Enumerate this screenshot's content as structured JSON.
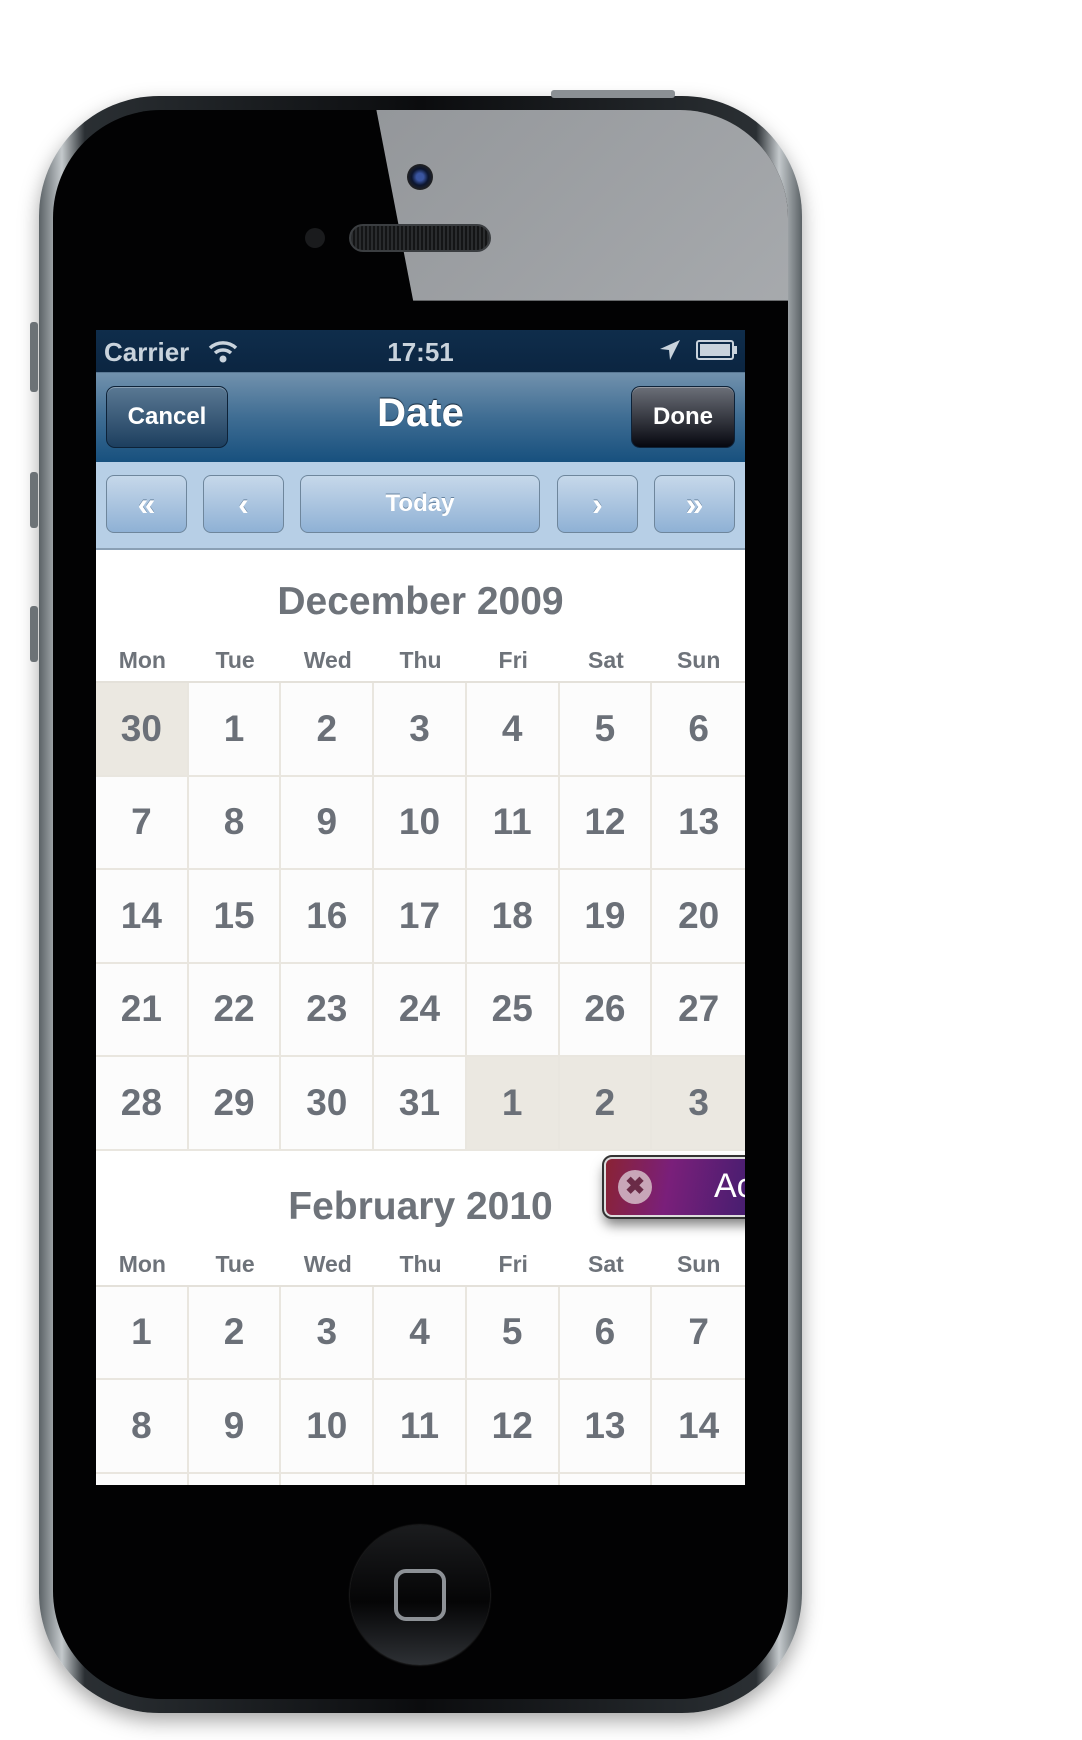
{
  "status_bar": {
    "carrier": "Carrier",
    "time": "17:51",
    "wifi_icon": "wifi-icon",
    "location_icon": "location-arrow-icon",
    "battery_icon": "battery-icon"
  },
  "nav_bar": {
    "title": "Date",
    "cancel_label": "Cancel",
    "done_label": "Done"
  },
  "toolbar": {
    "prev_year": "«",
    "prev_month": "‹",
    "today_label": "Today",
    "next_month": "›",
    "next_year": "»"
  },
  "weekdays": [
    "Mon",
    "Tue",
    "Wed",
    "Thu",
    "Fri",
    "Sat",
    "Sun"
  ],
  "months": [
    {
      "title": "December 2009",
      "days": [
        {
          "d": "30",
          "other": true
        },
        {
          "d": "1"
        },
        {
          "d": "2"
        },
        {
          "d": "3"
        },
        {
          "d": "4"
        },
        {
          "d": "5"
        },
        {
          "d": "6"
        },
        {
          "d": "7"
        },
        {
          "d": "8"
        },
        {
          "d": "9"
        },
        {
          "d": "10"
        },
        {
          "d": "11"
        },
        {
          "d": "12"
        },
        {
          "d": "13"
        },
        {
          "d": "14"
        },
        {
          "d": "15"
        },
        {
          "d": "16"
        },
        {
          "d": "17"
        },
        {
          "d": "18"
        },
        {
          "d": "19"
        },
        {
          "d": "20"
        },
        {
          "d": "21"
        },
        {
          "d": "22"
        },
        {
          "d": "23"
        },
        {
          "d": "24"
        },
        {
          "d": "25"
        },
        {
          "d": "26"
        },
        {
          "d": "27"
        },
        {
          "d": "28"
        },
        {
          "d": "29"
        },
        {
          "d": "30"
        },
        {
          "d": "31"
        },
        {
          "d": "1",
          "other": true
        },
        {
          "d": "2",
          "other": true
        },
        {
          "d": "3",
          "other": true
        }
      ]
    },
    {
      "title": "February 2010",
      "days": [
        {
          "d": "1"
        },
        {
          "d": "2"
        },
        {
          "d": "3"
        },
        {
          "d": "4"
        },
        {
          "d": "5"
        },
        {
          "d": "6"
        },
        {
          "d": "7"
        },
        {
          "d": "8"
        },
        {
          "d": "9"
        },
        {
          "d": "10"
        },
        {
          "d": "11"
        },
        {
          "d": "12"
        },
        {
          "d": "13"
        },
        {
          "d": "14"
        },
        {
          "d": ""
        },
        {
          "d": ""
        },
        {
          "d": ""
        },
        {
          "d": ""
        },
        {
          "d": ""
        },
        {
          "d": ""
        },
        {
          "d": ""
        }
      ]
    }
  ],
  "toast": {
    "text": "Ac",
    "close_icon": "close-icon"
  },
  "colors": {
    "nav_bar": "#17507e",
    "toolbar": "#b7cfe6",
    "day_text": "#6b7078",
    "other_month_bg": "#ebe8e1"
  }
}
